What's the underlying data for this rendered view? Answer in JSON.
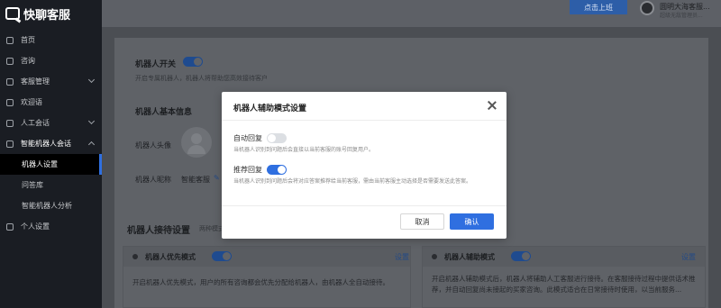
{
  "brand": {
    "name": "快聊客服"
  },
  "sidebar": {
    "items": [
      {
        "label": "首页",
        "icon": "home-icon"
      },
      {
        "label": "咨询",
        "icon": "chat-icon"
      },
      {
        "label": "客服管理",
        "icon": "agent-icon"
      },
      {
        "label": "欢迎语",
        "icon": "greeting-icon"
      },
      {
        "label": "人工会话",
        "icon": "session-icon"
      },
      {
        "label": "智能机器人会话",
        "icon": "robot-icon"
      }
    ],
    "sub_items": [
      {
        "label": "机器人设置",
        "active": true
      },
      {
        "label": "问答库",
        "active": false
      },
      {
        "label": "智能机器人分析",
        "active": false
      }
    ],
    "bottom_item": {
      "label": "个人设置",
      "icon": "user-icon"
    }
  },
  "topbar": {
    "online_button": "点击上班",
    "user_name": "圆明大海客服...",
    "user_sub": "超级无敌管理员..."
  },
  "page": {
    "robot_switch_title": "机器人开关",
    "robot_switch_hint": "开启专属机器人，机器人将帮助您高效接待客户",
    "basic_info_title": "机器人基本信息",
    "avatar_label": "机器人头像",
    "nickname_label": "机器人昵称",
    "nickname_value": "智能客服",
    "reception_title": "机器人接待设置",
    "reception_hint": "两种模式可以...",
    "priority_mode": {
      "title": "机器人优先模式",
      "settings": "设置",
      "desc": "开启机器人优先模式，用户的所有咨询都会优先分配给机器人，由机器人全自动接待。"
    },
    "assist_mode": {
      "title": "机器人辅助模式",
      "settings": "设置",
      "desc": "开启机器人辅助模式后，机器人将辅助人工客服进行接待。在客服接待过程中提供话术推荐，并自动回复尚未接起的买家咨询。此模式适合在日常接待时使用，以当前服务..."
    }
  },
  "modal": {
    "title": "机器人辅助模式设置",
    "auto_reply": {
      "label": "自动回复",
      "enabled": false,
      "hint": "当机器人识别到问题后会直接以当前客服的账号回复用户。"
    },
    "recommend_reply": {
      "label": "推荐回复",
      "enabled": true,
      "hint": "当机器人识别到问题后会将对应答案推荐给当前客服，需由当前客服主动选择是否需要发送此答案。"
    },
    "cancel": "取消",
    "confirm": "确认"
  },
  "colors": {
    "primary": "#2f6fe0",
    "sidebar_bg": "#1a1d23"
  }
}
